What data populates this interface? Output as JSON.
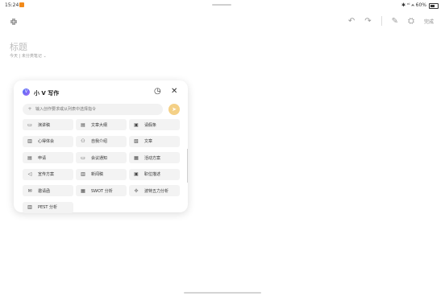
{
  "status": {
    "time": "15:24",
    "indicators": "✱ ⁿᴵ ⩜ 60%",
    "accent": "#f28a1a"
  },
  "toolbar": {
    "expand_icon": "fullscreen-icon",
    "undo": "↶",
    "redo": "↷",
    "pen": "✎",
    "share": "⛭",
    "done": "完成"
  },
  "note": {
    "title_placeholder": "标题",
    "meta": "今天 | 未分类笔记 ⌄"
  },
  "panel": {
    "logo": "V",
    "title": "小 V 写作",
    "history_glyph": "◷",
    "close_glyph": "✕",
    "search_plus": "+",
    "search_placeholder": "输入创作要求或从列表中选择指令",
    "send_glyph": "➤",
    "send_color": "#f4d086",
    "items": [
      {
        "label": "演讲稿",
        "icon": "▭"
      },
      {
        "label": "文章大纲",
        "icon": "▤"
      },
      {
        "label": "请假条",
        "icon": "▣"
      },
      {
        "label": "心得体会",
        "icon": "▥"
      },
      {
        "label": "自我介绍",
        "icon": "⚇"
      },
      {
        "label": "文章",
        "icon": "▧"
      },
      {
        "label": "申请",
        "icon": "▤"
      },
      {
        "label": "会议通知",
        "icon": "▭"
      },
      {
        "label": "活动方案",
        "icon": "▦"
      },
      {
        "label": "宣传方案",
        "icon": "◁"
      },
      {
        "label": "新闻稿",
        "icon": "▥"
      },
      {
        "label": "职位描述",
        "icon": "▣"
      },
      {
        "label": "邀请函",
        "icon": "✉"
      },
      {
        "label": "SWOT 分析",
        "icon": "▦"
      },
      {
        "label": "波特五力分析",
        "icon": "✢"
      },
      {
        "label": "PEST 分析",
        "icon": "▥"
      }
    ]
  }
}
